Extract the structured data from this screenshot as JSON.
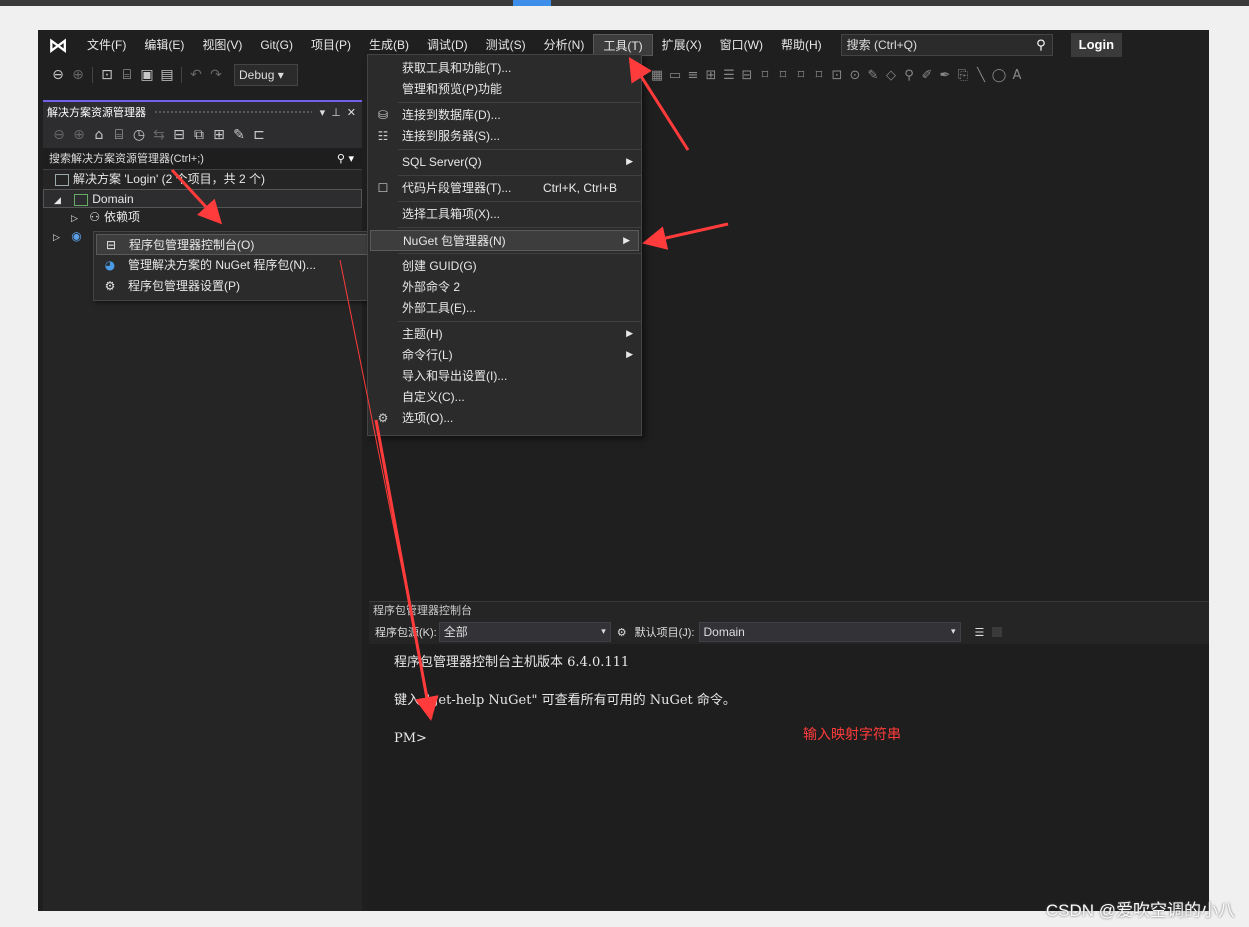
{
  "menubar": {
    "logo": "⋈",
    "items": [
      "文件(F)",
      "编辑(E)",
      "视图(V)",
      "Git(G)",
      "项目(P)",
      "生成(B)",
      "调试(D)",
      "测试(S)",
      "分析(N)",
      "工具(T)",
      "扩展(X)",
      "窗口(W)",
      "帮助(H)"
    ],
    "search_placeholder": "搜索 (Ctrl+Q)",
    "search_icon": "magnifier-icon",
    "login_label": "Login"
  },
  "toolbar": {
    "configuration": "Debug"
  },
  "solution_explorer": {
    "title": "解决方案资源管理器",
    "search_placeholder": "搜索解决方案资源管理器(Ctrl+;)",
    "tree": {
      "solution": "解决方案 'Login' (2 个项目，共 2 个)",
      "project": "Domain",
      "dependencies": "依赖项"
    }
  },
  "context_menu": {
    "items": [
      {
        "label": "程序包管理器控制台(O)",
        "icon": "console-icon"
      },
      {
        "label": "管理解决方案的 NuGet 程序包(N)...",
        "icon": "nuget-icon"
      },
      {
        "label": "程序包管理器设置(P)",
        "icon": "gear-icon"
      }
    ]
  },
  "tools_menu": {
    "items": [
      {
        "label": "获取工具和功能(T)..."
      },
      {
        "label": "管理和预览(P)功能"
      },
      {
        "label": "连接到数据库(D)..."
      },
      {
        "label": "连接到服务器(S)..."
      },
      {
        "label": "SQL Server(Q)"
      },
      {
        "label": "代码片段管理器(T)...",
        "shortcut": "Ctrl+K, Ctrl+B"
      },
      {
        "label": "选择工具箱项(X)..."
      },
      {
        "label": "NuGet 包管理器(N)"
      },
      {
        "label": "创建 GUID(G)"
      },
      {
        "label": "外部命令 2"
      },
      {
        "label": "外部工具(E)..."
      },
      {
        "label": "主题(H)"
      },
      {
        "label": "命令行(L)"
      },
      {
        "label": "导入和导出设置(I)..."
      },
      {
        "label": "自定义(C)..."
      },
      {
        "label": "选项(O)..."
      }
    ]
  },
  "pmc": {
    "title": "程序包管理器控制台",
    "source_label": "程序包源(K):",
    "source_value": "全部",
    "default_project_label": "默认项目(J):",
    "default_project_value": "Domain",
    "output": {
      "line1": "程序包管理器控制台主机版本 6.4.0.111",
      "line2": "键入 \"get-help NuGet\" 可查看所有可用的 NuGet 命令。",
      "prompt": "PM>"
    },
    "annotation": "输入映射字符串"
  },
  "watermark": "CSDN @爱吹空调的小八",
  "colors": {
    "accent": "#7160e8",
    "annotation_red": "#ff3b3b",
    "background": "#1f1f1f"
  }
}
